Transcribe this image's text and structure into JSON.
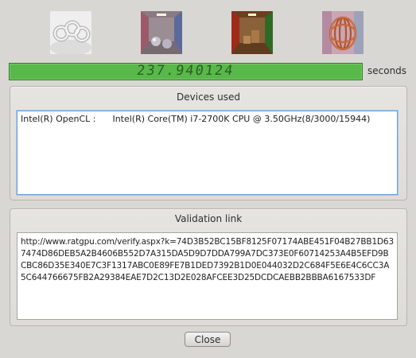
{
  "thumbnails": [
    {
      "icon": "render-knots-icon"
    },
    {
      "icon": "render-cornell-spheres-icon"
    },
    {
      "icon": "render-cornell-box-icon"
    },
    {
      "icon": "render-copper-mesh-icon"
    }
  ],
  "timer": {
    "value": "237.940124",
    "unit": "seconds"
  },
  "devices": {
    "title": "Devices used",
    "rows": [
      "Intel(R) OpenCL :      Intel(R) Core(TM) i7-2700K CPU @ 3.50GHz(8/3000/15944)"
    ]
  },
  "validation": {
    "title": "Validation link",
    "url": "http://www.ratgpu.com/verify.aspx?k=74D3B52BC15BF8125F07174ABE451F04B27BB1D637474D86DEB5A2B4606B552D7A315DA5D9D7DDA799A7DC373E0F60714253A4B5EFD9BCBC86D35E340E7C3F1317ABC0E89FE7B1DED7392B1D0E044032D2C684F5E6E4C6CC3A5C644766675FB2A29384EAE7D2C13D2E028AFCEE3D25DCDCAEBB2BBBA6167533DF"
  },
  "actions": {
    "close_label": "Close"
  },
  "colors": {
    "lcd_background": "#59b84a",
    "lcd_digits": "#2a5f25",
    "focus_border": "#6c9fd4"
  }
}
